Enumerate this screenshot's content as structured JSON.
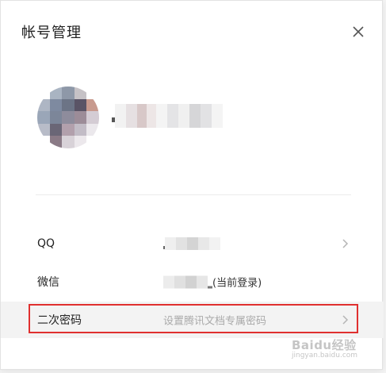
{
  "dialog": {
    "title": "帐号管理"
  },
  "accounts": [
    {
      "label": "QQ",
      "value": "",
      "has_chevron": true
    },
    {
      "label": "微信",
      "value": "(当前登录)",
      "has_chevron": false
    }
  ],
  "security": {
    "label": "二次密码",
    "placeholder": "设置腾讯文档专属密码",
    "has_chevron": true
  },
  "watermark": {
    "text": "Baidu经验",
    "subtext": "jingyan.baidu.com"
  },
  "colors": {
    "highlight_border": "#e0302f",
    "row_highlight_bg": "#f3f3f3"
  },
  "icons": {
    "close": "close-icon",
    "chevron": "chevron-right-icon"
  }
}
